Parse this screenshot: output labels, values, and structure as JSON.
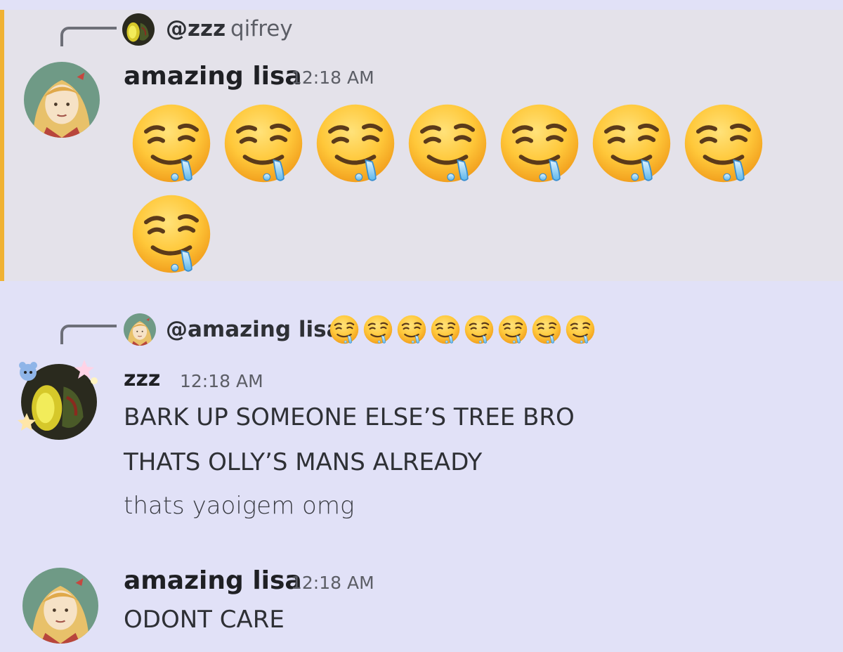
{
  "messages": [
    {
      "reply": {
        "mention": "@zzz",
        "text": "qifrey"
      },
      "author": "amazing lisa",
      "time": "12:18 AM",
      "emoji": {
        "name": "drooling-face-icon",
        "glyph": "🤤",
        "count": 8
      }
    },
    {
      "reply": {
        "mention": "@amazing lisa",
        "emoji_count": 8
      },
      "author": "zzz",
      "time": "12:18 AM",
      "lines": [
        "BARK UP SOMEONE ELSE’S TREE BRO",
        "THATS OLLY’S MANS ALREADY",
        "thats yaoigem omg"
      ]
    },
    {
      "author": "amazing lisa",
      "time": "12:18 AM",
      "lines": [
        "ODONT CARE"
      ]
    }
  ],
  "colors": {
    "background": "#e1e1f7",
    "highlight_bg": "#e4e2ea",
    "mention_bar": "#f0b232",
    "username": "#1f2024",
    "timestamp": "#5c5e66"
  }
}
